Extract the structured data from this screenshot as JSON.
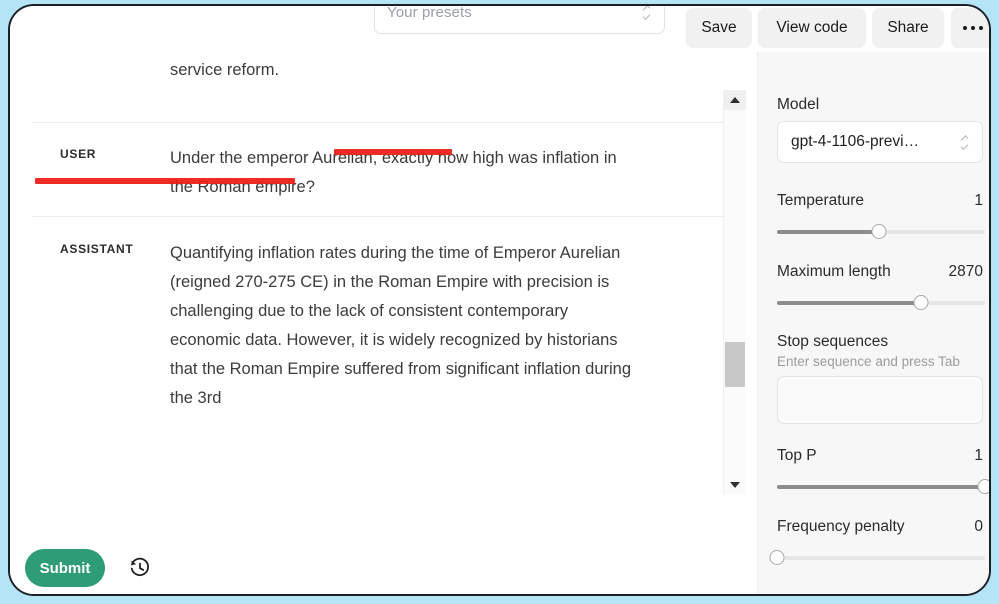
{
  "theme": {
    "page_background": "#b4e5f6",
    "panel_background": "#ffffff",
    "sidebar_background": "#f7f7f7",
    "submit_green": "#2e9c77",
    "annotation_red": "#ee1b14"
  },
  "top_bar": {
    "preset_placeholder": "Your presets",
    "preset_value": "",
    "save_label": "Save",
    "view_code_label": "View code",
    "share_label": "Share",
    "more_icon": "ellipsis-horizontal-icon",
    "preset_chevron_icon": "chevron-up-down-icon"
  },
  "conversation": {
    "messages": [
      {
        "role": "",
        "text": "service reform.",
        "clipped": true
      },
      {
        "role": "USER",
        "text": "Under the emperor Aurelian, exactly how high was inflation in the Roman empire?",
        "annotations": [
          {
            "name": "red-underline-line-1",
            "color": "#ee1b14"
          },
          {
            "name": "red-underline-line-2",
            "color": "#ee1b14"
          }
        ]
      },
      {
        "role": "ASSISTANT",
        "text": "Quantifying inflation rates during the time of Emperor Aurelian (reigned 270-275 CE) in the Roman Empire with precision is challenging due to the lack of consistent contemporary economic data. However, it is widely recognized by historians that the Roman Empire suffered from significant inflation during the 3rd"
      }
    ],
    "scrollbar": {
      "up_arrow_icon": "triangle-up-icon",
      "down_arrow_icon": "triangle-down-icon"
    }
  },
  "bottom_bar": {
    "submit_label": "Submit",
    "history_icon": "history-clock-icon"
  },
  "sidebar": {
    "model": {
      "label": "Model",
      "value": "gpt-4-1106-previ…",
      "chevron_icon": "chevron-up-down-icon"
    },
    "temperature": {
      "label": "Temperature",
      "value": "1"
    },
    "maximum_length": {
      "label": "Maximum length",
      "value": "2870"
    },
    "stop_sequences": {
      "label": "Stop sequences",
      "hint": "Enter sequence and press Tab",
      "value": ""
    },
    "top_p": {
      "label": "Top P",
      "value": "1"
    },
    "frequency_penalty": {
      "label": "Frequency penalty",
      "value": "0"
    }
  }
}
